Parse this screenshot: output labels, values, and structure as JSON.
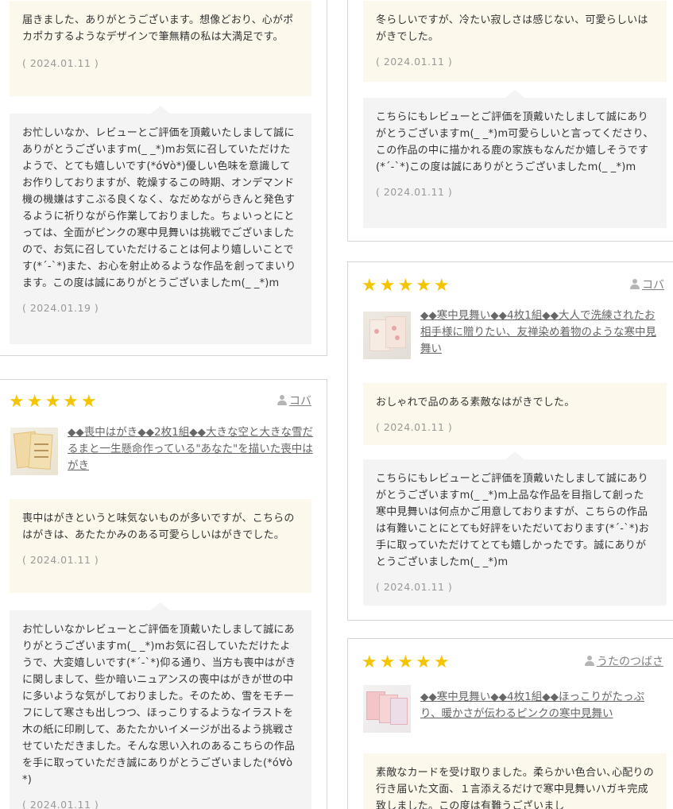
{
  "left": {
    "card1": {
      "review_text": "届きました、ありがとうございます。想像どおり、心がポカポカするようなデザインで筆無精の私は大満足です。",
      "review_date": "( 2024.01.11 )",
      "reply_text": "お忙しいなか、レビューとご評価を頂戴いたしまして誠にありがとうございますm(_ _*)mお気に召していただけたようで、とても嬉しいです(*ó∀ò*)優しい色味を意識してお作りしておりますが、乾燥するこの時期、オンデマンド機の機嫌はすこぶる良くなく、なだめながらきんと発色するように祈りながら作業しておりました。ちょいっとにとっては、全面がピンクの寒中見舞いは挑戦でございましたので、お気に召していただけることは何より嬉しいことです(*´-`*)また、お心を射止めるような作品を創ってまいります。この度は誠にありがとうございましたm(_ _*)m",
      "reply_date": "( 2024.01.19 )"
    },
    "card2": {
      "stars": "★★★★★",
      "user": "コバ",
      "product": "◆◆喪中はがき◆◆2枚1組◆◆大きな空と大きな雪だるまと一生懸命作っている\"あなた\"を描いた喪中はがき",
      "review_text": "喪中はがきというと味気ないものが多いですが、こちらのはがきは、あたたかみのある可愛らしいはがきでした。",
      "review_date": "( 2024.01.11 )",
      "reply_text": "お忙しいなかレビューとご評価を頂戴いたしまして誠にありがとうございますm(_ _*)mお気に召していただけたようで、大変嬉しいです(*´-`*)仰る通り、当方も喪中はがきに関しまして、些か暗いニュアンスの喪中はがきが世の中に多いような気がしておりました。そのため、雪をモチーフにして寒さも出しつつ、ほっこりするようなイラストを木の紙に印刷して、あたたかいイメージが出るよう挑戦させていただきました。そんな思い入れのあるこちらの作品を手に取っていただき誠にありがとうございました(*ó∀ò*)",
      "reply_date": "( 2024.01.11 )"
    }
  },
  "right": {
    "card1": {
      "review_text": "冬らしいですが、冷たい寂しさは感じない、可愛らしいはがきでした。",
      "review_date": "( 2024.01.11 )",
      "reply_text": "こちらにもレビューとご評価を頂戴いたしまして誠にありがとうございますm(_ _*)m可愛らしいと言ってくださり、この作品の中に描かれる鹿の家族もなんだか嬉しそうです(*´-`*)この度は誠にありがとうございましたm(_ _*)m",
      "reply_date": "( 2024.01.11 )"
    },
    "card2": {
      "stars": "★★★★★",
      "user": "コバ",
      "product": "◆◆寒中見舞い◆◆4枚1組◆◆大人で洗練されたお相手様に贈りたい、友禅染め着物のような寒中見舞い",
      "review_text": "おしゃれで品のある素敵なはがきでした。",
      "review_date": "( 2024.01.11 )",
      "reply_text": "こちらにもレビューとご評価を頂戴いたしまして誠にありがとうございますm(_ _*)m上品な作品を目指して創った寒中見舞いは何点かご用意しておりますが、こちらの作品は有難いことにとても好評をいただいております(*´-`*)お手に取っていただけてとても嬉しかったです。誠にありがとうございましたm(_ _*)m",
      "reply_date": "( 2024.01.11 )"
    },
    "card3": {
      "stars": "★★★★★",
      "user": "うたのつばさ",
      "product": "◆◆寒中見舞い◆◆4枚1組◆◆ほっこりがたっぷり、暖かさが伝わるピンクの寒中見舞い",
      "review_text": "素敵なカードを受け取りました。柔らかい色合い､心配りの行き届いた文面、１言添えるだけで寒中見舞いハガキ完成致しました。この度は有難うございまし"
    }
  }
}
